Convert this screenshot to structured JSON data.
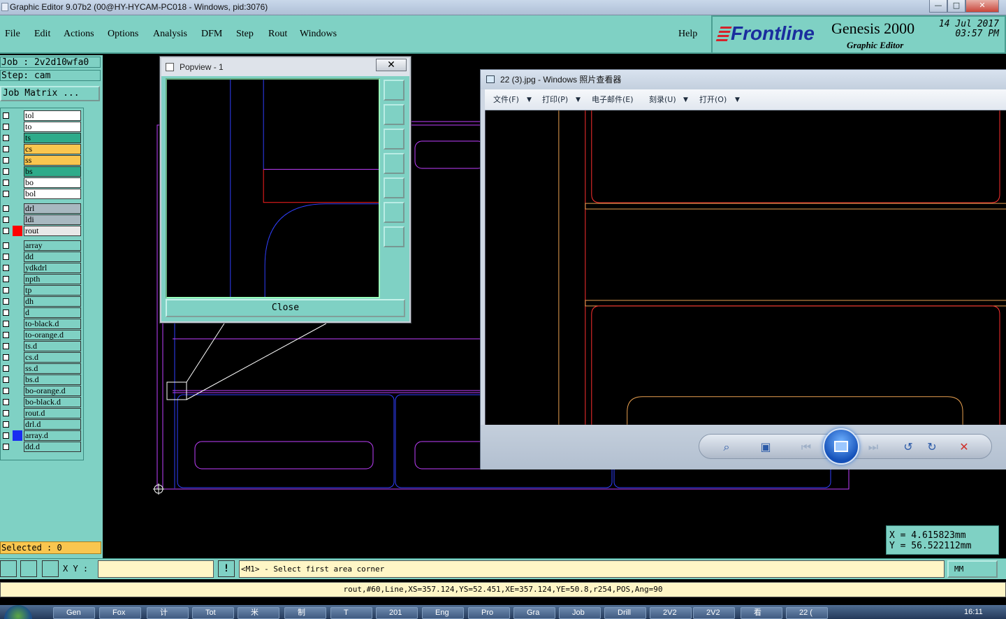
{
  "window": {
    "title": "Graphic Editor 9.07b2 (00@HY-HYCAM-PC018 - Windows, pid:3076)",
    "min": "—",
    "max": "□",
    "close": "✕"
  },
  "menu": {
    "items": [
      "File",
      "Edit",
      "Actions",
      "Options",
      "Analysis",
      "DFM",
      "Step",
      "Rout",
      "Windows"
    ],
    "help": "Help"
  },
  "brand": {
    "logo": "Frontline",
    "product": "Genesis 2000",
    "subtitle": "Graphic Editor",
    "date": "14 Jul 2017",
    "time": "03:57 PM"
  },
  "info": {
    "job": "Job : 2v2d10wfa0",
    "step": "Step: cam",
    "job_matrix": "Job Matrix ..."
  },
  "layers": [
    {
      "name": "tol",
      "color": "#ffffff",
      "swatch": ""
    },
    {
      "name": "to",
      "color": "#ffffff",
      "swatch": ""
    },
    {
      "name": "ts",
      "color": "#2eab8a",
      "swatch": ""
    },
    {
      "name": "cs",
      "color": "#f9c64f",
      "swatch": ""
    },
    {
      "name": "ss",
      "color": "#f9c64f",
      "swatch": ""
    },
    {
      "name": "bs",
      "color": "#2eab8a",
      "swatch": ""
    },
    {
      "name": "bo",
      "color": "#ffffff",
      "swatch": ""
    },
    {
      "name": "bol",
      "color": "#ffffff",
      "swatch": ""
    },
    {
      "name": "drl",
      "color": "#a8b8c0",
      "swatch": ""
    },
    {
      "name": "ldi",
      "color": "#a8b8c0",
      "swatch": ""
    },
    {
      "name": "rout",
      "color": "#e8e8e8",
      "swatch": "#ff0000"
    },
    {
      "name": "array",
      "color": "#7fd1c4",
      "swatch": ""
    },
    {
      "name": "dd",
      "color": "#7fd1c4",
      "swatch": ""
    },
    {
      "name": "ydkdrl",
      "color": "#7fd1c4",
      "swatch": ""
    },
    {
      "name": "npth",
      "color": "#7fd1c4",
      "swatch": ""
    },
    {
      "name": "tp",
      "color": "#7fd1c4",
      "swatch": ""
    },
    {
      "name": "dh",
      "color": "#7fd1c4",
      "swatch": ""
    },
    {
      "name": "d",
      "color": "#7fd1c4",
      "swatch": ""
    },
    {
      "name": "to-black.d",
      "color": "#7fd1c4",
      "swatch": ""
    },
    {
      "name": "to-orange.d",
      "color": "#7fd1c4",
      "swatch": ""
    },
    {
      "name": "ts.d",
      "color": "#7fd1c4",
      "swatch": ""
    },
    {
      "name": "cs.d",
      "color": "#7fd1c4",
      "swatch": ""
    },
    {
      "name": "ss.d",
      "color": "#7fd1c4",
      "swatch": ""
    },
    {
      "name": "bs.d",
      "color": "#7fd1c4",
      "swatch": ""
    },
    {
      "name": "bo-orange.d",
      "color": "#7fd1c4",
      "swatch": ""
    },
    {
      "name": "bo-black.d",
      "color": "#7fd1c4",
      "swatch": ""
    },
    {
      "name": "rout.d",
      "color": "#7fd1c4",
      "swatch": ""
    },
    {
      "name": "drl.d",
      "color": "#7fd1c4",
      "swatch": ""
    },
    {
      "name": "array.d",
      "color": "#7fd1c4",
      "swatch": "#1a2df0"
    },
    {
      "name": "dd.d",
      "color": "#7fd1c4",
      "swatch": ""
    }
  ],
  "selected": "Selected : 0",
  "cmd": {
    "xy_label": "X Y :",
    "xy_value": "",
    "message": "<M1> - Select first area corner",
    "unit": "MM"
  },
  "coords": {
    "x": "X = 4.615823mm",
    "y": "Y = 56.522112mm"
  },
  "status": "rout,#60,Line,XS=357.124,YS=52.451,XE=357.124,YE=50.8,r254,POS,Ang=90",
  "popview": {
    "title": "Popview - 1",
    "close_x": "✕",
    "close_button": "Close"
  },
  "viewer": {
    "title": "22 (3).jpg - Windows 照片查看器",
    "menu": [
      "文件(F)",
      "打印(P)",
      "电子邮件(E)",
      "刻录(U)",
      "打开(O)"
    ]
  },
  "taskbar": {
    "items": [
      "Gen",
      "Fox",
      "计",
      "Tot",
      "米",
      "制",
      "T",
      "201",
      "Eng",
      "Pro",
      "Gra",
      "Job",
      "Drill",
      "2V2",
      "2V2",
      "看",
      "22 ("
    ],
    "clock": "16:11"
  }
}
